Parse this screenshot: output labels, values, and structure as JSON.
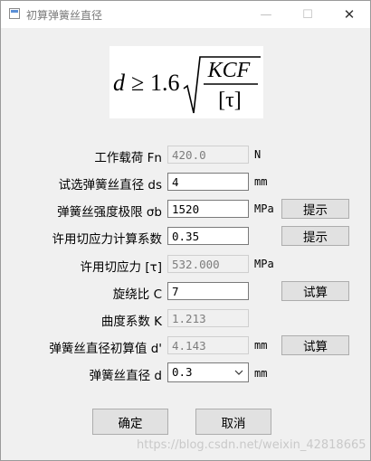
{
  "window": {
    "title": "初算弹簧丝直径",
    "minimize": "—",
    "maximize": "☐",
    "close": "✕"
  },
  "formula": {
    "lhs": "d",
    "rel": "≥",
    "coef": "1.6",
    "numerator": "KCF",
    "denominator": "[τ]"
  },
  "rows": [
    {
      "label": "工作载荷 Fn",
      "value": "420.0",
      "unit": "N"
    },
    {
      "label": "试选弹簧丝直径 ds",
      "value": "4",
      "unit": "mm"
    },
    {
      "label": "弹簧丝强度极限 σb",
      "value": "1520",
      "unit": "MPa",
      "button": "提示"
    },
    {
      "label": "许用切应力计算系数",
      "value": "0.35",
      "button": "提示"
    },
    {
      "label": "许用切应力 [τ]",
      "value": "532.000",
      "unit": "MPa"
    },
    {
      "label": "旋绕比 C",
      "value": "7",
      "button": "试算"
    },
    {
      "label": "曲度系数 K",
      "value": "1.213"
    },
    {
      "label": "弹簧丝直径初算值 d'",
      "value": "4.143",
      "unit": "mm",
      "button": "试算"
    },
    {
      "label": "弹簧丝直径 d",
      "value": "0.3",
      "unit": "mm"
    }
  ],
  "actions": {
    "ok": "确定",
    "cancel": "取消"
  },
  "watermark": "https://blog.csdn.net/weixin_42818665"
}
